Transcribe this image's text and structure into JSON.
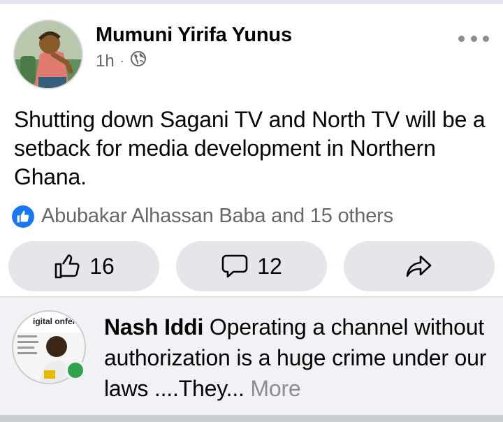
{
  "post": {
    "author": "Mumuni Yirifa Yunus",
    "time": "1h",
    "separator": "·",
    "privacy_icon": "globe-icon",
    "body": "Shutting down Sagani TV and North TV will be a setback for media development in Northern Ghana.",
    "reactions_summary": "Abubakar Alhassan Baba and 15 others",
    "actions": {
      "like_count": "16",
      "comment_count": "12"
    }
  },
  "comment": {
    "author": "Nash Iddi",
    "text": " Operating a channel without authorization is a huge crime under our laws ....They...",
    "more_label": " More",
    "avatar_banner": "igital onference",
    "online": true
  },
  "colors": {
    "like_blue": "#1877f2",
    "online_green": "#31a24c",
    "secondary_text": "#65676b",
    "button_bg": "#e4e6eb"
  }
}
